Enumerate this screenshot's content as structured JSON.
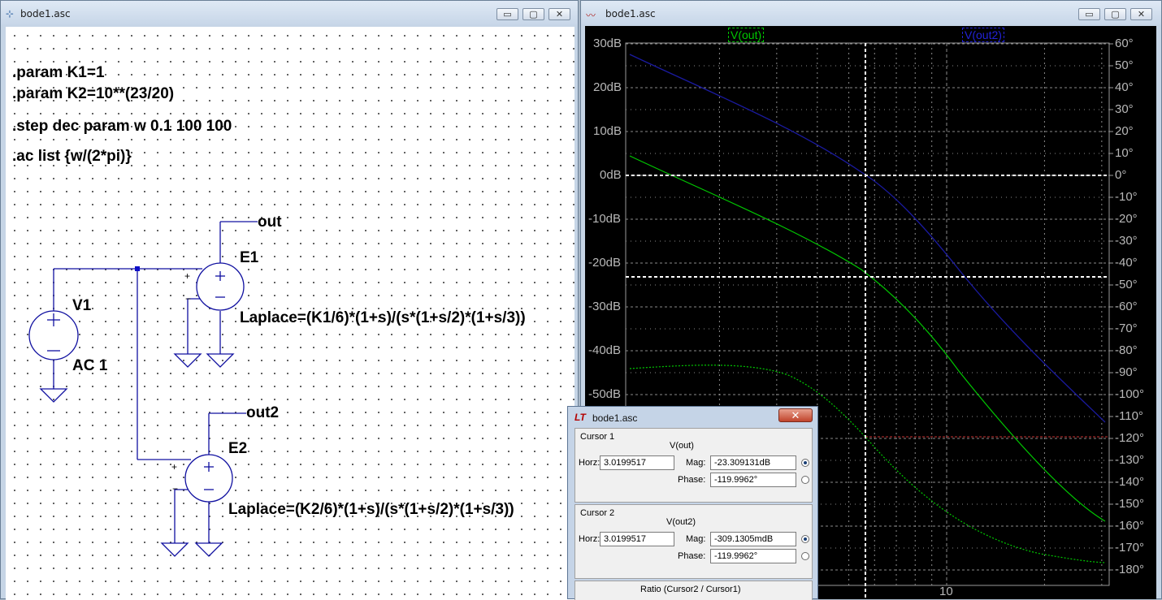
{
  "schematic_window": {
    "title": "bode1.asc",
    "buttons": {
      "minimize": "▭",
      "maximize": "▢",
      "close": "✕"
    },
    "directives": [
      ".param K1=1",
      ".param K2=10**(23/20)",
      ".step dec param w 0.1 100 100",
      ".ac list {w/(2*pi)}"
    ],
    "labels": {
      "out": "out",
      "out2": "out2",
      "e1": "E1",
      "e2": "E2",
      "v1": "V1",
      "ac": "AC 1",
      "laplace1": "Laplace=(K1/6)*(1+s)/(s*(1+s/2)*(1+s/3))",
      "laplace2": "Laplace=(K2/6)*(1+s)/(s*(1+s/2)*(1+s/3))",
      "plus": "+",
      "minus": "−"
    }
  },
  "waveform_window": {
    "title": "bode1.asc",
    "buttons": {
      "minimize": "▭",
      "maximize": "▢",
      "close": "✕"
    },
    "traces": [
      {
        "name": "V(out)",
        "color": "#00c800"
      },
      {
        "name": "V(out2)",
        "color": "#0000c8"
      }
    ],
    "left_axis": [
      "30dB",
      "20dB",
      "10dB",
      "0dB",
      "-10dB",
      "-20dB",
      "-30dB",
      "-40dB",
      "-50dB"
    ],
    "right_axis": [
      "60°",
      "50°",
      "40°",
      "30°",
      "20°",
      "10°",
      "0°",
      "-10°",
      "-20°",
      "-30°",
      "-40°",
      "-50°",
      "-60°",
      "-70°",
      "-80°",
      "-90°",
      "-100°",
      "-110°",
      "-120°",
      "-130°",
      "-140°",
      "-150°",
      "-160°",
      "-170°",
      "-180°"
    ],
    "x_tick": "10",
    "colors": {
      "grid": "#8a8a8a",
      "cursor": "#ffffff",
      "vout": "#00c800",
      "vout2": "#1a1aa0",
      "phase_ref": "#c83232"
    }
  },
  "cursor_dialog": {
    "title": "bode1.asc",
    "close_label": "✕",
    "cursor1": {
      "header": "Cursor 1",
      "trace": "V(out)",
      "horz_label": "Horz:",
      "horz": "3.0199517",
      "mag_label": "Mag:",
      "mag": "-23.309131dB",
      "phase_label": "Phase:",
      "phase": "-119.9962°"
    },
    "cursor2": {
      "header": "Cursor 2",
      "trace": "V(out2)",
      "horz_label": "Horz:",
      "horz": "3.0199517",
      "mag_label": "Mag:",
      "mag": "-309.1305mdB",
      "phase_label": "Phase:",
      "phase": "-119.9962°"
    },
    "ratio_header": "Ratio (Cursor2 / Cursor1)"
  }
}
